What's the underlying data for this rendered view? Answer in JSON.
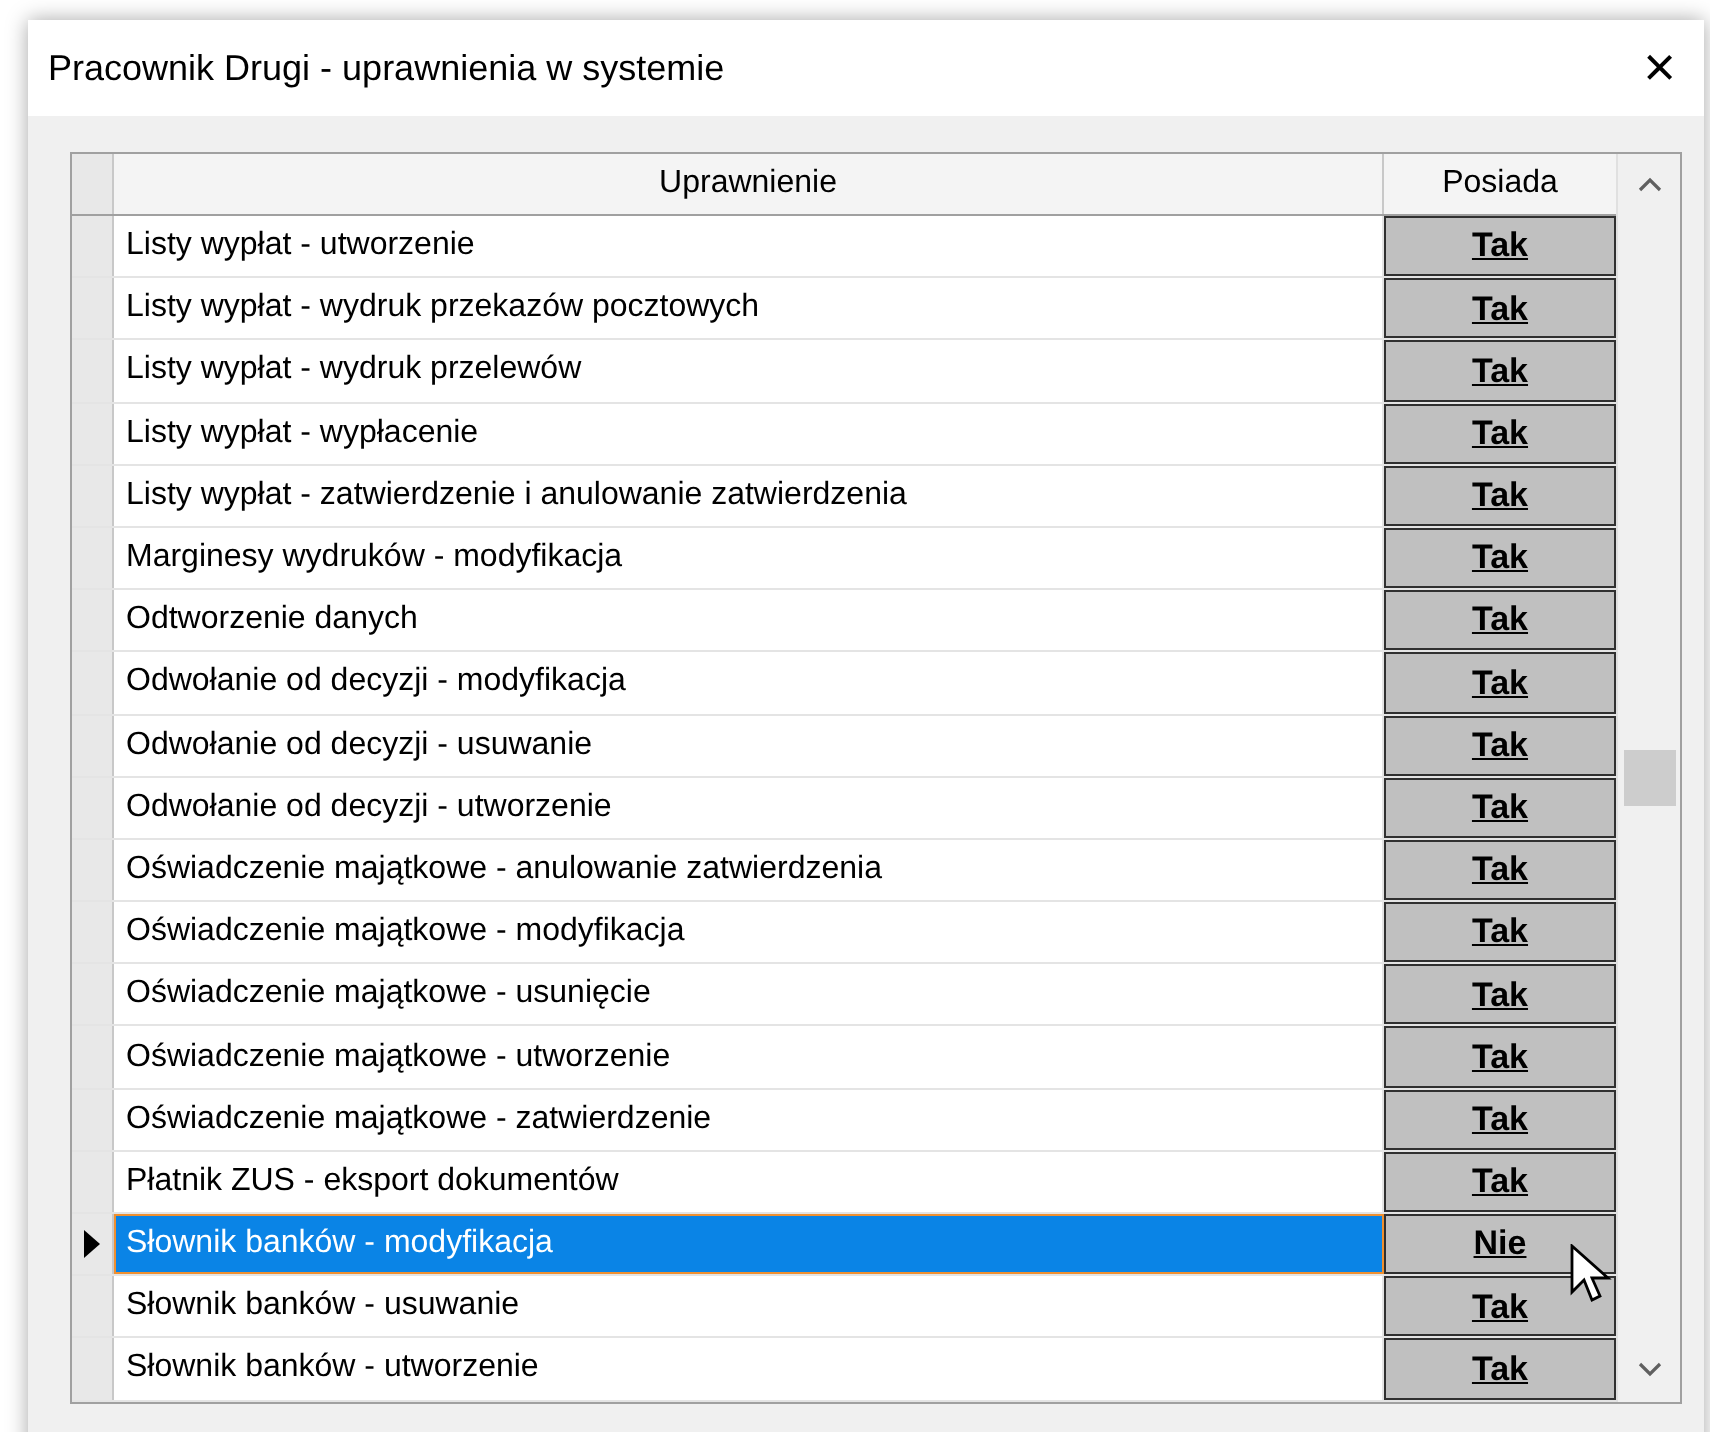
{
  "window": {
    "title": "Pracownik Drugi - uprawnienia w systemie",
    "close": "×"
  },
  "table": {
    "columns": [
      "Uprawnienie",
      "Posiada"
    ],
    "rows": [
      {
        "name": "Listy wypłat - utworzenie",
        "value": "Tak",
        "selected": false
      },
      {
        "name": "Listy wypłat - wydruk przekazów pocztowych",
        "value": "Tak",
        "selected": false
      },
      {
        "name": "Listy wypłat - wydruk przelewów",
        "value": "Tak",
        "selected": false
      },
      {
        "name": "Listy wypłat - wypłacenie",
        "value": "Tak",
        "selected": false
      },
      {
        "name": "Listy wypłat - zatwierdzenie i anulowanie zatwierdzenia",
        "value": "Tak",
        "selected": false
      },
      {
        "name": "Marginesy wydruków - modyfikacja",
        "value": "Tak",
        "selected": false
      },
      {
        "name": "Odtworzenie danych",
        "value": "Tak",
        "selected": false
      },
      {
        "name": "Odwołanie od decyzji - modyfikacja",
        "value": "Tak",
        "selected": false
      },
      {
        "name": "Odwołanie od decyzji - usuwanie",
        "value": "Tak",
        "selected": false
      },
      {
        "name": "Odwołanie od decyzji - utworzenie",
        "value": "Tak",
        "selected": false
      },
      {
        "name": "Oświadczenie majątkowe - anulowanie zatwierdzenia",
        "value": "Tak",
        "selected": false
      },
      {
        "name": "Oświadczenie majątkowe - modyfikacja",
        "value": "Tak",
        "selected": false
      },
      {
        "name": "Oświadczenie majątkowe - usunięcie",
        "value": "Tak",
        "selected": false
      },
      {
        "name": "Oświadczenie majątkowe - utworzenie",
        "value": "Tak",
        "selected": false
      },
      {
        "name": "Oświadczenie majątkowe - zatwierdzenie",
        "value": "Tak",
        "selected": false
      },
      {
        "name": "Płatnik ZUS - eksport dokumentów",
        "value": "Tak",
        "selected": false
      },
      {
        "name": "Słownik banków - modyfikacja",
        "value": "Nie",
        "selected": true
      },
      {
        "name": "Słownik banków - usuwanie",
        "value": "Tak",
        "selected": false
      },
      {
        "name": "Słownik banków - utworzenie",
        "value": "Tak",
        "selected": false
      }
    ]
  }
}
